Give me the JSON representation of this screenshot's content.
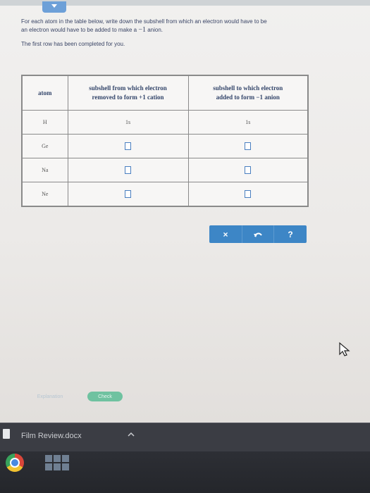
{
  "instructions": {
    "line1": "For each atom in the table below, write down the subshell from which an electron would have to be",
    "line2_pre": "an electron would have to be added to make a",
    "line2_charge": "−1",
    "line2_post": "anion.",
    "line3": "The first row has been completed for you."
  },
  "table": {
    "col_atom": "atom",
    "col_cation_line1": "subshell from which electron",
    "col_cation_line2_pre": "removed to form",
    "col_cation_charge": "+1",
    "col_cation_line2_post": "cation",
    "col_anion_line1": "subshell to which electron",
    "col_anion_line2_pre": "added to form",
    "col_anion_charge": "−1",
    "col_anion_line2_post": "anion",
    "rows": [
      {
        "atom": "H",
        "cation": "1s",
        "anion": "1s"
      },
      {
        "atom": "Ge"
      },
      {
        "atom": "Na"
      },
      {
        "atom": "Ne"
      }
    ]
  },
  "toolbar": {
    "clear_label": "×",
    "help_label": "?"
  },
  "footer": {
    "explanation_label": "Explanation",
    "check_label": "Check"
  },
  "taskbar": {
    "download_name": "Film Review.docx"
  },
  "colors": {
    "accent": "#3d86c6",
    "check": "#6fc2a0",
    "text": "#3a4566"
  }
}
